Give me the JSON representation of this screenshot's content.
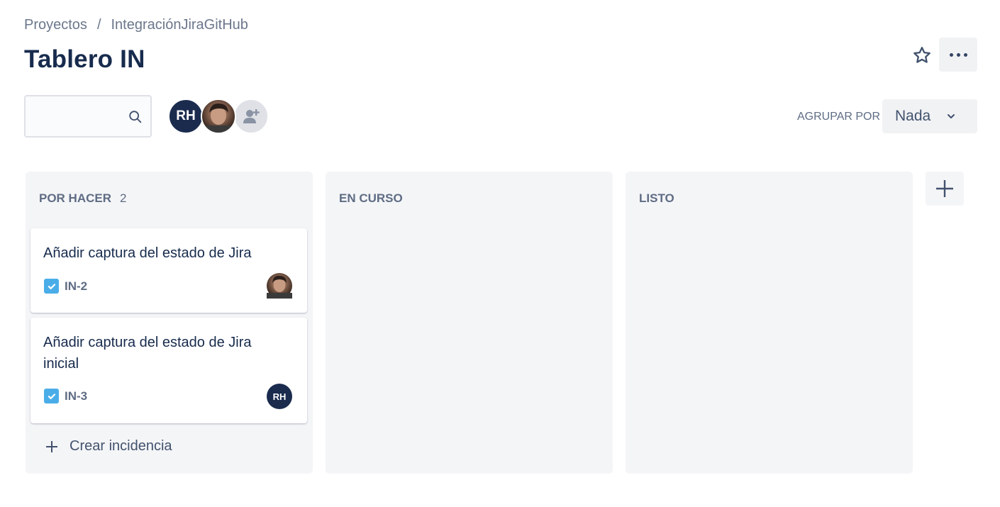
{
  "breadcrumb": {
    "items": [
      "Proyectos",
      "IntegraciónJiraGitHub"
    ],
    "separator": "/"
  },
  "page": {
    "title": "Tablero IN"
  },
  "header_actions": {
    "star_icon": "star-icon",
    "more_icon": "more-icon"
  },
  "search": {
    "placeholder": "",
    "value": ""
  },
  "avatars": {
    "initials": "RH",
    "add_icon": "add-person-icon"
  },
  "group_by": {
    "label": "AGRUPAR POR",
    "value": "Nada"
  },
  "columns": [
    {
      "title": "POR HACER",
      "count": "2",
      "cards": [
        {
          "title": "Añadir captura del estado de Jira",
          "key": "IN-2",
          "assignee": "photo"
        },
        {
          "title": "Añadir captura del estado de Jira inicial",
          "key": "IN-3",
          "assignee": "RH"
        }
      ],
      "create_label": "Crear incidencia"
    },
    {
      "title": "EN CURSO",
      "count": ""
    },
    {
      "title": "LISTO",
      "count": ""
    }
  ],
  "colors": {
    "accent_dark": "#1a2b4e",
    "column_bg": "#f4f5f7",
    "task_icon": "#4bade8",
    "text_primary": "#172b4d",
    "text_secondary": "#5e6c84"
  }
}
